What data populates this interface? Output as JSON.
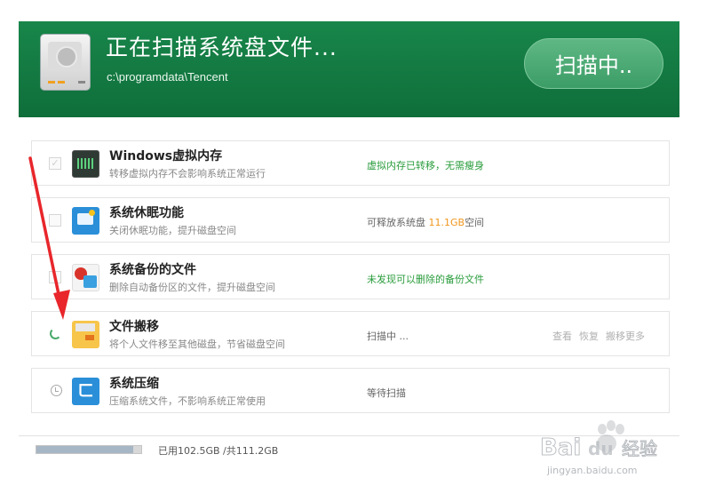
{
  "header": {
    "title": "正在扫描系统盘文件...",
    "path": "c:\\programdata\\Tencent",
    "scan_button": "扫描中.."
  },
  "items": [
    {
      "name": "Windows虚拟内存",
      "desc": "转移虚拟内存不会影响系统正常运行",
      "status": "虚拟内存已转移，无需瘦身",
      "icon": "memory-icon"
    },
    {
      "name": "系统休眠功能",
      "desc": "关闭休眠功能，提升磁盘空间",
      "status_prefix": "可释放系统盘 ",
      "status_highlight": "11.1GB",
      "status_suffix": "空间",
      "icon": "hibernate-icon"
    },
    {
      "name": "系统备份的文件",
      "desc": "删除自动备份区的文件，提升磁盘空间",
      "status": "未发现可以删除的备份文件",
      "icon": "backup-icon"
    },
    {
      "name": "文件搬移",
      "desc": "将个人文件移至其他磁盘，节省磁盘空间",
      "status": "扫描中 ...",
      "icon": "folder-move-icon",
      "actions": [
        "查看",
        "恢复",
        "搬移更多"
      ]
    },
    {
      "name": "系统压缩",
      "desc": "压缩系统文件，不影响系统正常使用",
      "status": "等待扫描",
      "icon": "compress-icon"
    }
  ],
  "footer": {
    "usage_text": "已用102.5GB /共111.2GB",
    "usage_fraction": 0.92
  },
  "watermark": {
    "logo": "Bai du 经验",
    "url": "jingyan.baidu.com"
  },
  "colors": {
    "header_green": "#158046",
    "ok_text": "#2a9c3c",
    "highlight": "#f0961e",
    "arrow_red": "#e8262b"
  }
}
